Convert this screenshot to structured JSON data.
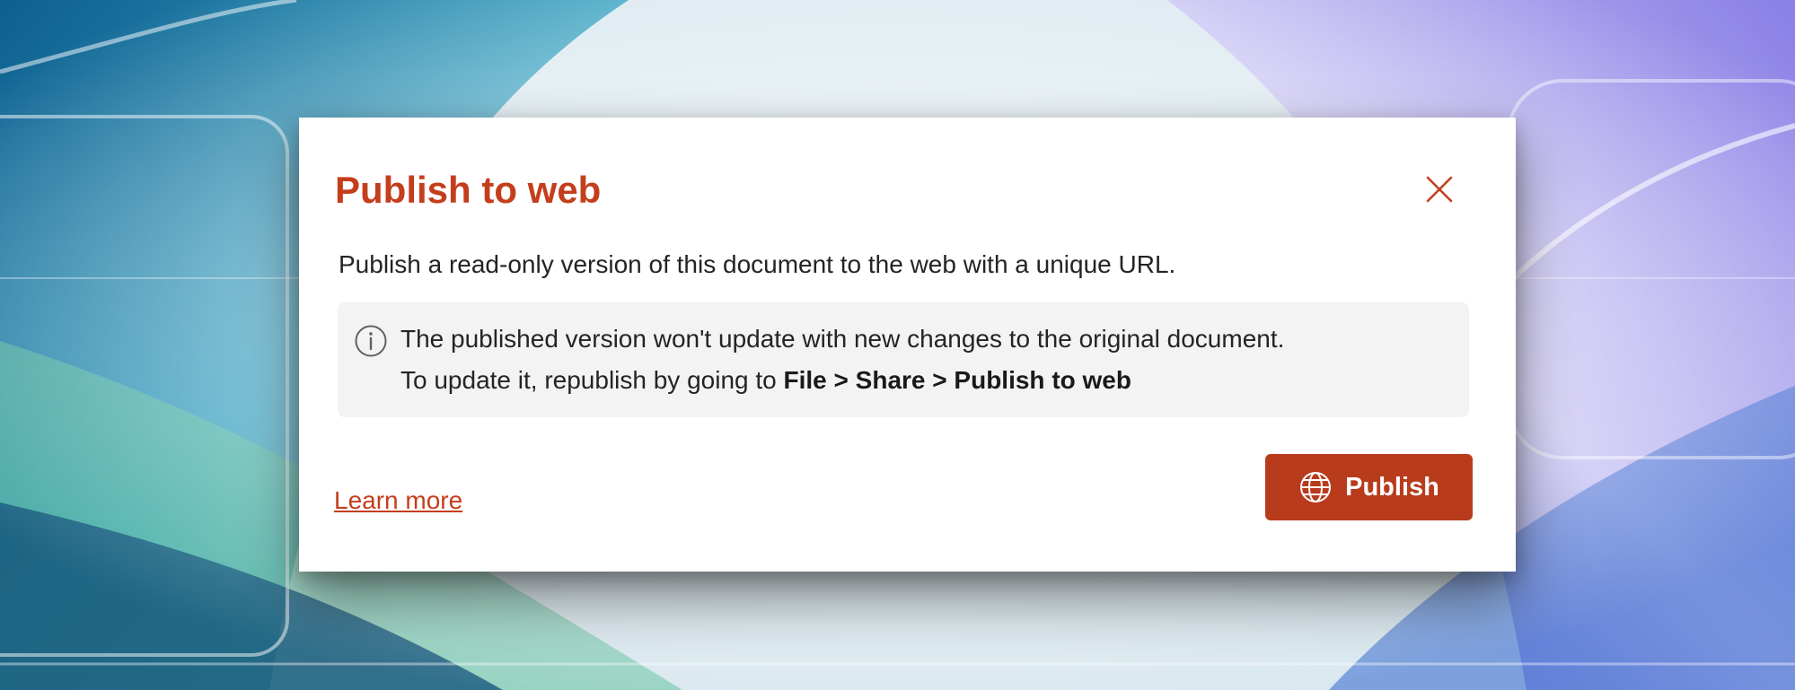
{
  "dialog": {
    "title": "Publish to web",
    "description": "Publish a read-only version of this document to the web with a unique URL.",
    "info": {
      "icon": "info-icon",
      "line1": "The published version won't update with new changes to the original document.",
      "line2_prefix": "To update it, republish by going to ",
      "path": {
        "file": "File",
        "sep1": " > ",
        "share": "Share",
        "sep2": " > ",
        "publish": "Publish to web"
      }
    },
    "learn_more": "Learn more",
    "publish_button": {
      "label": "Publish",
      "icon": "globe-icon"
    },
    "close_icon": "close-icon"
  },
  "colors": {
    "accent": "#c43e1c",
    "button": "#b83b1b",
    "info_bg": "#f3f3f3",
    "text": "#242424"
  }
}
